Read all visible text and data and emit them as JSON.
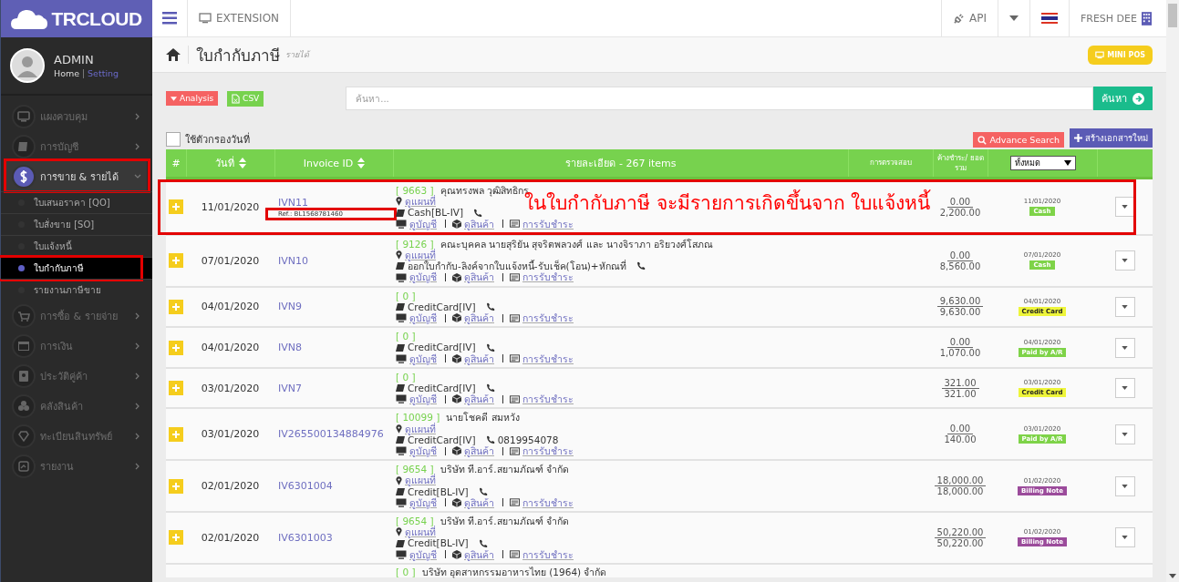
{
  "brand": "TRCLOUD",
  "topbar": {
    "extension": "EXTENSION",
    "api": "API",
    "company": "FRESH DEE"
  },
  "user": {
    "name": "ADMIN",
    "home": "Home",
    "setting": "Setting"
  },
  "menu": [
    {
      "label": "แผงควบคุม",
      "selected": false,
      "expanded": false,
      "highlighted": false
    },
    {
      "label": "การบัญชี",
      "selected": false,
      "expanded": false,
      "highlighted": false
    },
    {
      "label": "การขาย & รายได้",
      "selected": true,
      "expanded": true,
      "highlighted": true,
      "children": [
        {
          "label": "ใบเสนอราคา [QO]",
          "selected": false,
          "highlighted": false
        },
        {
          "label": "ใบสั่งขาย [SO]",
          "selected": false,
          "highlighted": false
        },
        {
          "label": "ใบแจ้งหนี้",
          "selected": false,
          "highlighted": false
        },
        {
          "label": "ใบกำกับภาษี",
          "selected": true,
          "highlighted": true
        },
        {
          "label": "รายงานภาษีขาย",
          "selected": false,
          "highlighted": false
        }
      ]
    },
    {
      "label": "การซื้อ & รายจ่าย",
      "selected": false,
      "expanded": false,
      "highlighted": false
    },
    {
      "label": "การเงิน",
      "selected": false,
      "expanded": false,
      "highlighted": false
    },
    {
      "label": "ประวัติคู่ค้า",
      "selected": false,
      "expanded": false,
      "highlighted": false
    },
    {
      "label": "คลังสินค้า",
      "selected": false,
      "expanded": false,
      "highlighted": false
    },
    {
      "label": "ทะเบียนสินทรัพย์",
      "selected": false,
      "expanded": false,
      "highlighted": false
    },
    {
      "label": "รายงาน",
      "selected": false,
      "expanded": false,
      "highlighted": false
    }
  ],
  "page": {
    "title": "ใบกำกับภาษี",
    "subtitle": "รายได้",
    "mini_pos": "MINI POS"
  },
  "toolbar": {
    "analysis": "Analysis",
    "csv": "CSV",
    "search_placeholder": "ค้นหา...",
    "search_button": "ค้นหา",
    "date_filter": {
      "label": "ใช้ตัวกรองวันที่",
      "checked": false
    },
    "advance_search": "Advance Search",
    "create": "สร้างเอกสารใหม่"
  },
  "table": {
    "columns": [
      "#",
      "วันที่",
      "Invoice ID",
      "รายละเอียด - 267 items",
      "การตรวจสอบ",
      "ค้างชำระ/ ยอดรวม"
    ],
    "status_filter": "ทั้งหมด",
    "rows": [
      {
        "date": "11/01/2020",
        "invoice": "IVN11",
        "ref": "Ref.: BL1568781460",
        "highlighted": true,
        "annotation": "ในใบกำกับภาษี จะมีรายการเกิดขึ้นจาก ใบแจ้งหนี้",
        "code": "[ 9663 ]",
        "name": "คุณทรงพล วุฒิสิทธิกร",
        "map": "ดูแผนที่",
        "payment": "Cash[BL-IV]",
        "links": [
          "ดูบัญชี",
          "ดูสินค้า",
          "การรับชำระ"
        ],
        "outstanding": "0.00",
        "total": "2,200.00",
        "status_date": "11/01/2020",
        "badge": {
          "label": "Cash",
          "color": "#7ed348"
        }
      },
      {
        "date": "07/01/2020",
        "invoice": "IVN10",
        "highlighted": false,
        "code": "[ 9126 ]",
        "name": "คณะบุคคล นายสุริยัน สุจริตพลวงศ์ และ นางจิราภา อริยวงศ์โสภณ",
        "map": "ดูแผนที่",
        "payment": "ออกใบกำกับ-ลิงค์จากใบแจ้งหนี้-รับเช็ค(โอน)+หักณที่",
        "links": [
          "ดูบัญชี",
          "ดูสินค้า",
          "การรับชำระ"
        ],
        "outstanding": "0.00",
        "total": "8,560.00",
        "status_date": "07/01/2020",
        "badge": {
          "label": "Cash",
          "color": "#7ed348"
        }
      },
      {
        "date": "04/01/2020",
        "invoice": "IVN9",
        "highlighted": false,
        "code": "[ 0 ]",
        "payment": "CreditCard[IV]",
        "links": [
          "ดูบัญชี",
          "ดูสินค้า",
          "การรับชำระ"
        ],
        "outstanding": "9,630.00",
        "total": "9,630.00",
        "status_date": "04/01/2020",
        "badge": {
          "label": "Credit Card",
          "color": "#eef53a"
        }
      },
      {
        "date": "04/01/2020",
        "invoice": "IVN8",
        "highlighted": false,
        "code": "[ 0 ]",
        "payment": "CreditCard[IV]",
        "links": [
          "ดูบัญชี",
          "ดูสินค้า",
          "การรับชำระ"
        ],
        "outstanding": "0.00",
        "total": "1,070.00",
        "status_date": "04/01/2020",
        "badge": {
          "label": "Paid by A/R",
          "color": "#7ed348"
        }
      },
      {
        "date": "03/01/2020",
        "invoice": "IVN7",
        "highlighted": false,
        "code": "[ 0 ]",
        "payment": "CreditCard[IV]",
        "links": [
          "ดูบัญชี",
          "ดูสินค้า",
          "การรับชำระ"
        ],
        "outstanding": "321.00",
        "total": "321.00",
        "status_date": "03/01/2020",
        "badge": {
          "label": "Credit Card",
          "color": "#eef53a"
        }
      },
      {
        "date": "03/01/2020",
        "invoice": "IV265500134884976",
        "highlighted": false,
        "code": "[ 10099 ]",
        "name": "นายโชคดี สมหวัง",
        "map": "ดูแผนที่",
        "payment": "CreditCard[IV]",
        "phone": "0819954078",
        "links": [
          "ดูบัญชี",
          "ดูสินค้า",
          "การรับชำระ"
        ],
        "outstanding": "0.00",
        "total": "140.00",
        "status_date": "03/01/2020",
        "badge": {
          "label": "Paid by A/R",
          "color": "#7ed348"
        }
      },
      {
        "date": "02/01/2020",
        "invoice": "IV6301004",
        "highlighted": false,
        "code": "[ 9654 ]",
        "name": "บริษัท ที.อาร์.สยามภัณฑ์ จำกัด",
        "map": "ดูแผนที่",
        "payment": "Credit[BL-IV]",
        "links": [
          "ดูบัญชี",
          "ดูสินค้า",
          "การรับชำระ"
        ],
        "outstanding": "18,000.00",
        "total": "18,000.00",
        "status_date": "01/02/2020",
        "badge": {
          "label": "Billing Note",
          "color": "#9b4b9b"
        }
      },
      {
        "date": "02/01/2020",
        "invoice": "IV6301003",
        "highlighted": false,
        "code": "[ 9654 ]",
        "name": "บริษัท ที.อาร์.สยามภัณฑ์ จำกัด",
        "map": "ดูแผนที่",
        "payment": "Credit[BL-IV]",
        "links": [
          "ดูบัญชี",
          "ดูสินค้า",
          "การรับชำระ"
        ],
        "outstanding": "50,220.00",
        "total": "50,220.00",
        "status_date": "01/02/2020",
        "badge": {
          "label": "Billing Note",
          "color": "#9b4b9b"
        }
      },
      {
        "highlighted": false,
        "code": "[ 0 ]",
        "name": "บริษัท อุตสาหกรรมอาหารไทย (1964) จำกัด"
      }
    ]
  }
}
